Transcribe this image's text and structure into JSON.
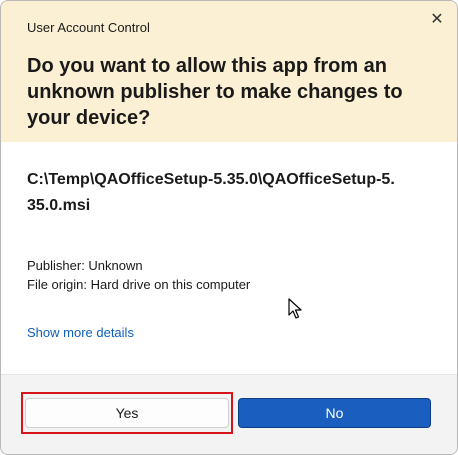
{
  "dialog": {
    "window_title": "User Account Control",
    "close_glyph": "✕",
    "question": "Do you want to allow this app from an unknown publisher to make changes to your device?",
    "app_path": "C:\\Temp\\QAOfficeSetup-5.35.0\\QAOfficeSetup-5.35.0.msi",
    "publisher": "Publisher: Unknown",
    "file_origin": "File origin: Hard drive on this computer",
    "show_more_details": "Show more details",
    "yes_label": "Yes",
    "no_label": "No"
  },
  "colors": {
    "header_bg": "#fbf0d3",
    "link": "#0f5fb8",
    "primary_button": "#1a5fc0",
    "highlight_border": "#d8141b"
  },
  "icons": {
    "close": "close-icon",
    "cursor": "mouse-pointer-icon"
  }
}
